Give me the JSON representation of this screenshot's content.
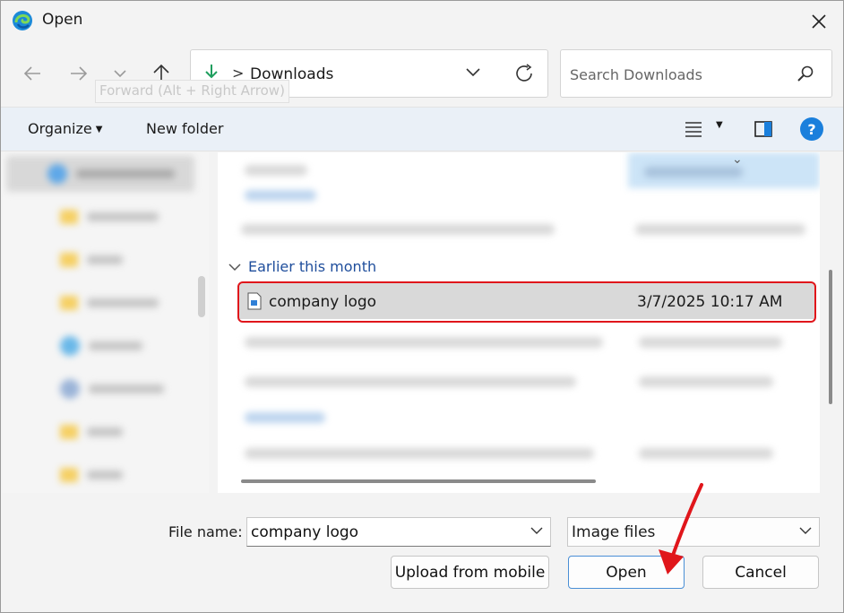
{
  "window": {
    "title": "Open",
    "close_icon": "close-icon"
  },
  "nav": {
    "back_icon": "arrow-left-icon",
    "forward_icon": "arrow-right-icon",
    "recent_icon": "chevron-down-icon",
    "up_icon": "arrow-up-icon",
    "tooltip": "Forward (Alt + Right Arrow)"
  },
  "address": {
    "location": "Downloads",
    "separator": ">"
  },
  "search": {
    "placeholder": "Search Downloads"
  },
  "toolbar": {
    "organize_label": "Organize",
    "new_folder_label": "New folder",
    "help_label": "?"
  },
  "file_list": {
    "group_header": "Earlier this month",
    "selected_file": {
      "name": "company logo",
      "date_modified": "3/7/2025 10:17 AM"
    }
  },
  "bottom": {
    "file_name_label": "File name:",
    "file_name_value": "company logo",
    "file_type_value": "Image files",
    "upload_label": "Upload from mobile",
    "open_label": "Open",
    "cancel_label": "Cancel"
  },
  "colors": {
    "accent": "#1a7fdc",
    "highlight": "#e0161b",
    "group_header": "#1f4e9c"
  }
}
